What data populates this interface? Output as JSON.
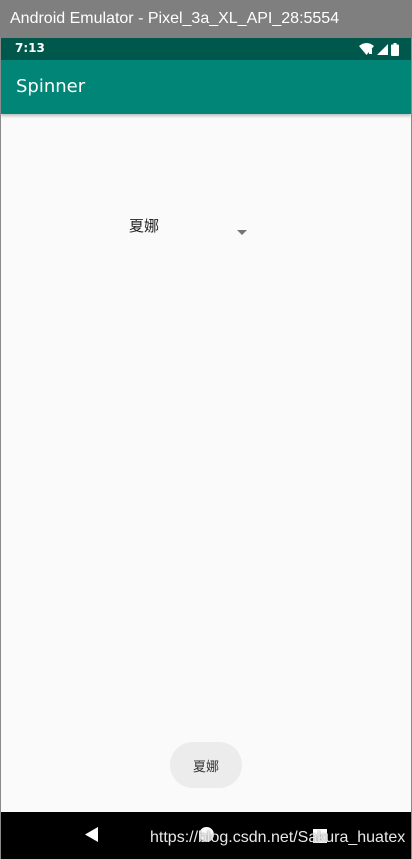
{
  "window": {
    "title": "Android Emulator - Pixel_3a_XL_API_28:5554"
  },
  "status_bar": {
    "time": "7:13",
    "icons": [
      "wifi-icon",
      "cell-signal-icon",
      "battery-icon"
    ]
  },
  "app_bar": {
    "title": "Spinner"
  },
  "spinner": {
    "selected": "夏娜"
  },
  "toast": {
    "text": "夏娜"
  },
  "nav_bar": {
    "buttons": [
      "back-icon",
      "home-icon",
      "recents-icon"
    ]
  },
  "watermark": {
    "text": "https://blog.csdn.net/Sakura_huatex"
  },
  "colors": {
    "primary": "#008577",
    "primary_dark": "#00574b",
    "background": "#fafafa"
  }
}
